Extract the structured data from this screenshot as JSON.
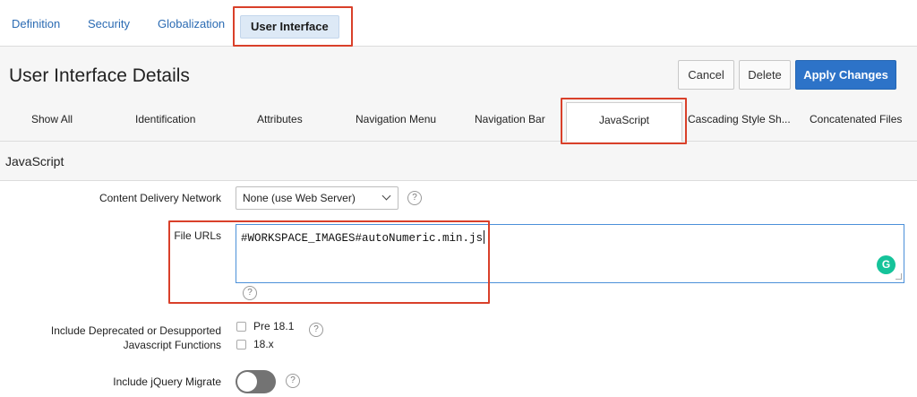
{
  "top_tabs": {
    "definition": "Definition",
    "security": "Security",
    "globalization": "Globalization",
    "user_interface": "User Interface"
  },
  "page": {
    "title": "User Interface Details"
  },
  "buttons": {
    "cancel": "Cancel",
    "delete": "Delete",
    "apply": "Apply Changes"
  },
  "sub_tabs": {
    "show_all": "Show All",
    "identification": "Identification",
    "attributes": "Attributes",
    "navigation_menu": "Navigation Menu",
    "navigation_bar": "Navigation Bar",
    "javascript": "JavaScript",
    "css": "Cascading Style Sh...",
    "concatenated": "Concatenated Files"
  },
  "region": {
    "title": "JavaScript"
  },
  "form": {
    "cdn_label": "Content Delivery Network",
    "cdn_value": "None (use Web Server)",
    "file_urls_label": "File URLs",
    "file_urls_value": "#WORKSPACE_IMAGES#autoNumeric.min.js",
    "deprecated_label_line1": "Include Deprecated or Desupported",
    "deprecated_label_line2": "Javascript Functions",
    "pre_18_1": "Pre 18.1",
    "v18x": "18.x",
    "jquery_migrate_label": "Include jQuery Migrate",
    "jquery_migrate_on": false
  },
  "help_glyph": "?",
  "grammarly_glyph": "G",
  "colors": {
    "accent": "#2d73c8",
    "link": "#2b6bb3",
    "highlight": "#d9402a",
    "grammarly": "#15c39a"
  }
}
